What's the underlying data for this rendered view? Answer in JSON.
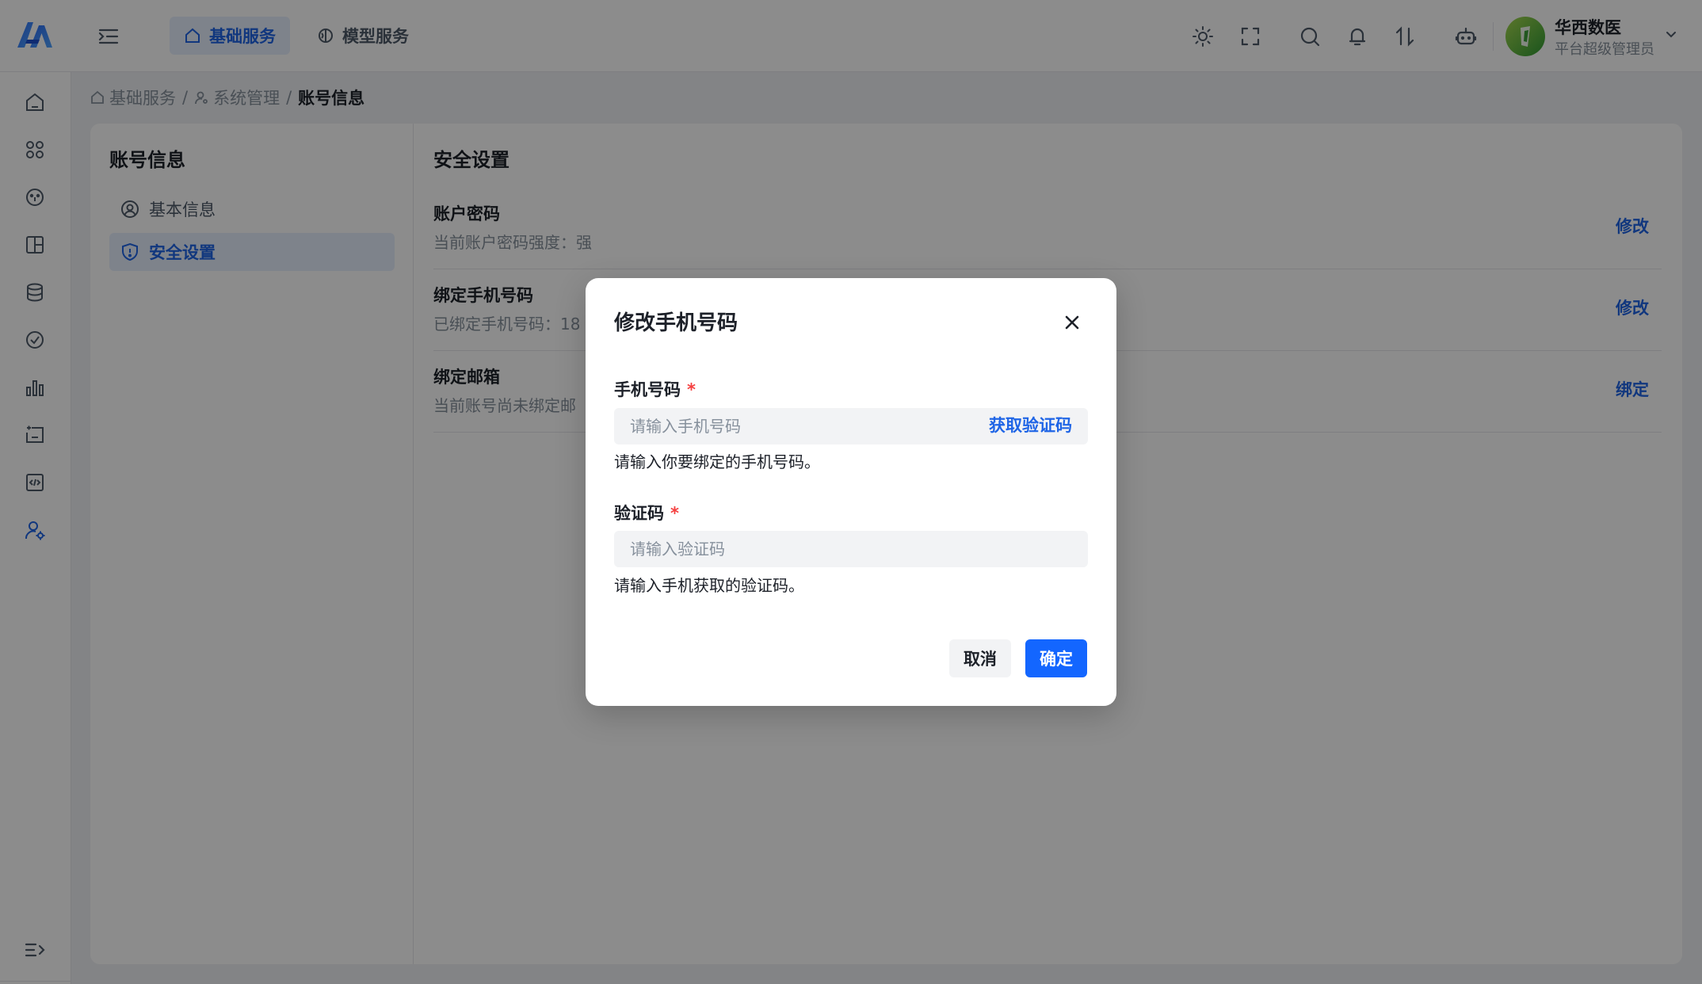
{
  "header": {
    "tabs": [
      {
        "label": "基础服务",
        "icon": "home-icon",
        "active": true
      },
      {
        "label": "模型服务",
        "icon": "brain-icon",
        "active": false
      }
    ],
    "user": {
      "name": "华西数医",
      "role": "平台超级管理员"
    }
  },
  "breadcrumb": {
    "items": [
      {
        "label": "基础服务",
        "icon": "home-icon"
      },
      {
        "label": "系统管理",
        "icon": "user-settings-icon"
      },
      {
        "label": "账号信息"
      }
    ],
    "separator": "/"
  },
  "left_panel": {
    "title": "账号信息",
    "items": [
      {
        "label": "基本信息",
        "icon": "user-circle-icon",
        "active": false
      },
      {
        "label": "安全设置",
        "icon": "shield-icon",
        "active": true
      }
    ]
  },
  "security": {
    "title": "安全设置",
    "rows": [
      {
        "title": "账户密码",
        "desc": "当前账户密码强度：强",
        "action": "修改"
      },
      {
        "title": "绑定手机号码",
        "desc": "已绑定手机号码：18",
        "action": "修改"
      },
      {
        "title": "绑定邮箱",
        "desc": "当前账号尚未绑定邮",
        "action": "绑定"
      }
    ]
  },
  "modal": {
    "title": "修改手机号码",
    "phone_label": "手机号码",
    "required_mark": "*",
    "phone_placeholder": "请输入手机号码",
    "get_code": "获取验证码",
    "phone_help": "请输入你要绑定的手机号码。",
    "code_label": "验证码",
    "code_placeholder": "请输入验证码",
    "code_help": "请输入手机获取的验证码。",
    "cancel": "取消",
    "ok": "确定"
  },
  "colors": {
    "accent": "#1366ff",
    "required": "#f53f3f",
    "active_bg": "#e6effe"
  }
}
